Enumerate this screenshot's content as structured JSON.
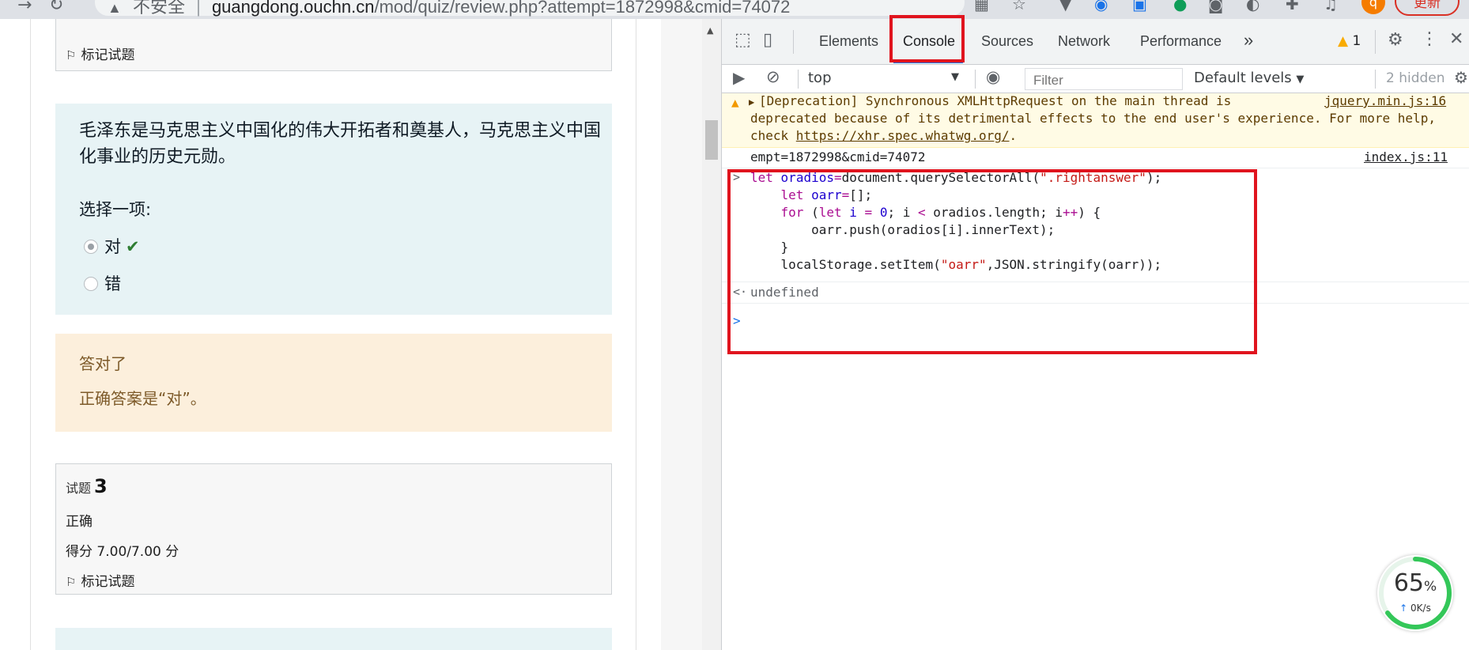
{
  "browser": {
    "security_label": "不安全",
    "url_host": "guangdong.ouchn.cn",
    "url_path": "/mod/quiz/review.php?attempt=1872998&cmid=74072",
    "avatar_letter": "q",
    "update_label": "更新"
  },
  "quiz": {
    "flag_label_top": "标记试题",
    "question_text": "毛泽东是马克思主义中国化的伟大开拓者和奠基人，马克思主义中国化事业的历史元勋。",
    "choose_prompt": "选择一项:",
    "options": [
      {
        "label": "对",
        "selected": true,
        "correct": true
      },
      {
        "label": "错",
        "selected": false,
        "correct": false
      }
    ],
    "feedback_title": "答对了",
    "feedback_answer": "正确答案是“对”。",
    "q3": {
      "label": "试题",
      "number": "3",
      "status": "正确",
      "score": "得分 7.00/7.00 分",
      "flag_label": "标记试题"
    }
  },
  "devtools": {
    "tabs": [
      "Elements",
      "Console",
      "Sources",
      "Network",
      "Performance"
    ],
    "active_tab": "Console",
    "more_tabs": "»",
    "warning_count": "1",
    "context": "top",
    "filter_placeholder": "Filter",
    "levels": "Default levels",
    "hidden_count": "2 hidden",
    "console": {
      "warning_line1": "[Deprecation] Synchronous XMLHttpRequest on the main thread is",
      "warning_line2": "deprecated because of its detrimental effects to the end user's experience. For more help,",
      "warning_line3_prefix": "check ",
      "warning_link": "https://xhr.spec.whatwg.org/",
      "warning_line3_suffix": ".",
      "warning_source": "jquery.min.js:16",
      "log_text": "empt=1872998&cmid=74072",
      "log_source": "index.js:11",
      "result": "undefined"
    }
  },
  "speed_widget": {
    "percent": "65",
    "percent_value": 65,
    "unit": "%",
    "rate": "0K/s"
  },
  "colors": {
    "annotation_red": "#e0141e",
    "devtools_blue": "#1a73e8"
  }
}
